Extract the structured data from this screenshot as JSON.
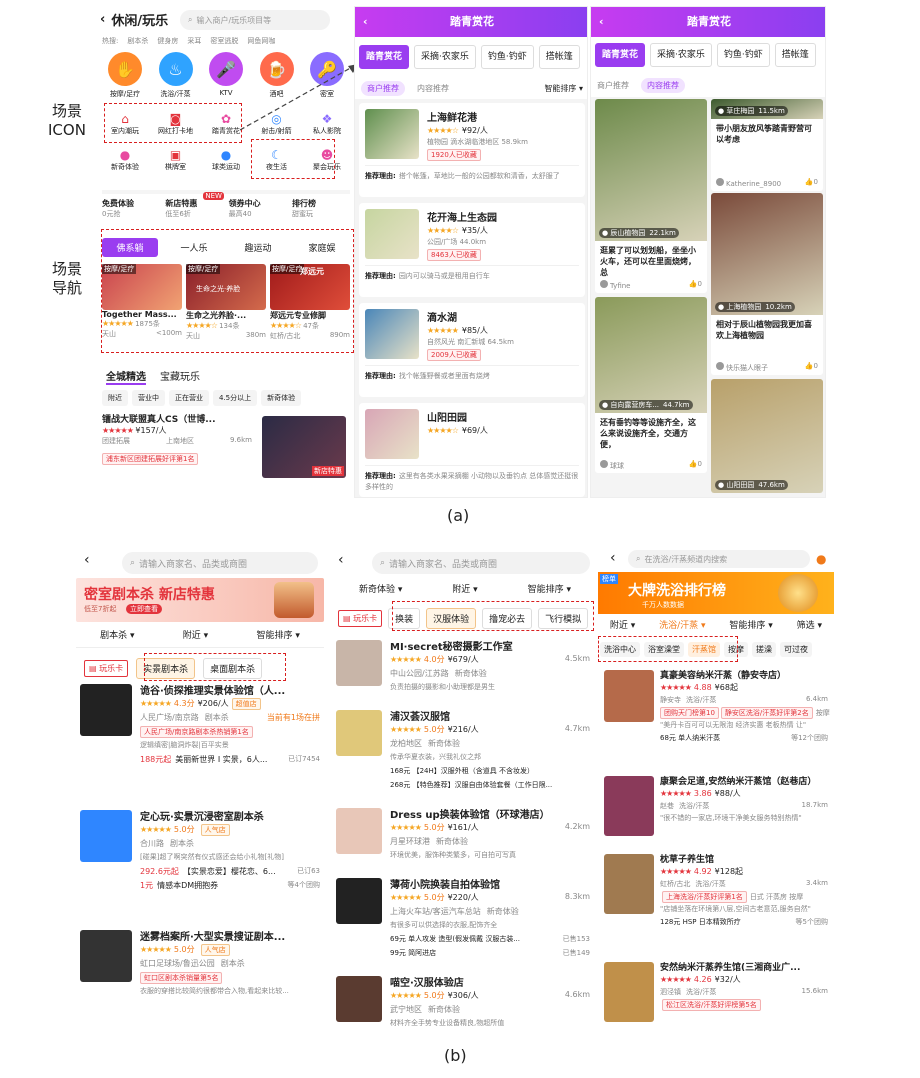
{
  "annot": {
    "scene_icon": "场景\nICON",
    "scene_nav": "场景\n导航",
    "cap_a": "(a)",
    "cap_b": "(b)"
  },
  "a1": {
    "title": "休闲/玩乐",
    "search_ph": "输入商户/玩乐项目等",
    "hot_label": "热搜:",
    "hot": [
      "剧本杀",
      "健身房",
      "采耳",
      "密室逃脱",
      "网鱼网咖"
    ],
    "icons": [
      {
        "label": "按摩/足疗",
        "color": "#ff8a2b",
        "glyph": "✋"
      },
      {
        "label": "洗浴/汗蒸",
        "color": "#2fa3ff",
        "glyph": "♨"
      },
      {
        "label": "KTV",
        "color": "#c04cf0",
        "glyph": "🎤"
      },
      {
        "label": "酒吧",
        "color": "#ff6a4c",
        "glyph": "🍺"
      },
      {
        "label": "密室",
        "color": "#8a6cff",
        "glyph": "🔑"
      }
    ],
    "scene1": [
      "室内潮玩",
      "网红打卡地",
      "踏青赏花"
    ],
    "row2_extra": [
      "射击/射箭",
      "私人影院"
    ],
    "row3": [
      "新奇体验",
      "棋牌室",
      "球类运动"
    ],
    "scene2": [
      "夜生活",
      "聚会玩乐"
    ],
    "promo": [
      {
        "title": "免费体验",
        "sub": "0元抢"
      },
      {
        "title": "新店特惠",
        "sub": "低至6折"
      },
      {
        "title": "领券中心",
        "sub": "最高40"
      },
      {
        "title": "排行榜",
        "sub": "甜蜜玩"
      }
    ],
    "new_badge": "NEW",
    "nav": [
      "佛系躺",
      "一人乐",
      "趣运动",
      "家庭娱"
    ],
    "shops": [
      {
        "tag": "按摩/足疗",
        "name": "Together Mass...",
        "count": "1875条",
        "area": "天山",
        "dist": "<100m"
      },
      {
        "tag": "按摩/足疗",
        "name": "生命之光养脸·...",
        "count": "134条",
        "area": "天山",
        "dist": "380m"
      },
      {
        "tag": "按摩/足疗",
        "name": "郑远元专业修脚",
        "count": "47条",
        "area": "虹桥/古北",
        "dist": "890m"
      }
    ],
    "img_text": [
      "生命之光·养脸",
      "郑远元"
    ],
    "sec_tabs": [
      "全城精选",
      "宝藏玩乐"
    ],
    "filters": [
      "附近",
      "营业中",
      "正在营业",
      "4.5分以上",
      "新奇体验"
    ],
    "deal": {
      "name": "镭战大联盟真人CS（世博...",
      "price": "¥157/人",
      "cat": "团建拓展",
      "area": "上南地区",
      "dist": "9.6km",
      "rank": "浦东新区团建拓展好评第1名",
      "thumb_label": "新店特惠"
    }
  },
  "a2": {
    "title": "踏青赏花",
    "tabs": [
      "踏青赏花",
      "采摘·农家乐",
      "钓鱼·钓虾",
      "搭帐篷"
    ],
    "sub": [
      "商户推荐",
      "内容推荐"
    ],
    "sort": "智能排序",
    "items": [
      {
        "name": "上海鲜花港",
        "price": "¥92/人",
        "loc": "植物园 滴水湖临港地区 58.9km",
        "coll": "1920人已收藏",
        "reason_label": "推荐理由:",
        "reason": "搭个帐篷，草地比一般的公园都软和清香，太舒服了"
      },
      {
        "name": "花开海上生态园",
        "price": "¥35/人",
        "loc": "公园/广场 44.0km",
        "coll": "8463人已收藏",
        "reason_label": "推荐理由:",
        "reason": "园内可以骑马或是租用自行车"
      },
      {
        "name": "滴水湖",
        "price": "¥85/人",
        "loc": "自然风光 南汇新城 64.5km",
        "coll": "2009人已收藏",
        "reason_label": "推荐理由:",
        "reason": "找个帐篷野餐或者里面有烧烤"
      },
      {
        "name": "山阳田园",
        "price": "¥69/人",
        "loc": "",
        "coll": "",
        "reason_label": "推荐理由:",
        "reason": "这里有各类水果采摘棚 小动物以及垂钓点 总体感觉还挺很多样性的"
      }
    ]
  },
  "a3": {
    "title": "踏青赏花",
    "tabs": [
      "踏青赏花",
      "采摘·农家乐",
      "钓鱼·钓虾",
      "搭帐篷"
    ],
    "sub": [
      "商户推荐",
      "内容推荐"
    ],
    "posts": [
      {
        "loc": "辰山植物园",
        "dist": "22.1km",
        "text": "逛累了可以划划船，坐坐小火车，还可以在里面烧烤，总",
        "user": "Tyfine",
        "likes": "0"
      },
      {
        "loc": "草庄梅园",
        "dist": "11.5km",
        "text": "带小朋友放风筝踏青野营可以考虑",
        "user": "Katherine_8900",
        "likes": "0"
      },
      {
        "loc": "上海植物园",
        "dist": "10.2km",
        "text": "相对于辰山植物园我更加喜欢上海植物园",
        "user": "快乐猫人眼子",
        "likes": "0"
      },
      {
        "loc": "自向露营房车...",
        "dist": "44.7km",
        "text": "还有垂钓等等设施齐全，这么来说设施齐全，交通方便，",
        "user": "球球",
        "likes": "0"
      },
      {
        "loc": "山阳田园",
        "dist": "47.6km",
        "text": "",
        "user": "",
        "likes": ""
      }
    ]
  },
  "b1": {
    "search_ph": "请输入商家名、品类或商圈",
    "banner": "密室剧本杀 新店特惠",
    "banner_sub": "低至7折起",
    "banner_btn": "立即查看",
    "filters": [
      "剧本杀",
      "附近",
      "智能排序"
    ],
    "card": "玩乐卡",
    "chips": [
      "实景剧本杀",
      "桌面剧本杀"
    ],
    "items": [
      {
        "name": "诡谷·侦探推理实景体验馆（人...",
        "score": "4.3分",
        "price": "¥206/人",
        "badge": "超值店",
        "area": "人民广场/南京路",
        "cat": "剧本杀",
        "extra": "当前有1场在拼",
        "rank": "人民广场/南京路剧本杀热销第1名",
        "tip": "逻辑缜密|脑洞炸裂|百平实景",
        "deal": "188元起",
        "deal_t": "美丽新世界 I 实景，6人...",
        "sold": "已订7454"
      },
      {
        "name": "定心玩·实景沉浸密室剧本杀",
        "score": "5.0分",
        "price": "",
        "badge": "人气店",
        "area": "合川路",
        "cat": "剧本杀",
        "extra": "",
        "rank": "",
        "tip": "[碰果]超了啊突然有仪式感还会给小礼物[礼物]",
        "deal": "292.6元起",
        "deal_t": "【实景恋爱】樱花恋、6...",
        "sold": "已订63",
        "deal2": "1元",
        "deal2_t": "情感本DM拥抱券",
        "sold2": "等4个团购"
      },
      {
        "name": "迷雾档案所·大型实景搜证剧本...",
        "score": "5.0分",
        "price": "",
        "badge": "人气店",
        "area": "虹口足球场/鲁迅公园",
        "cat": "剧本杀",
        "extra": "",
        "rank": "虹口区剧本杀销量第5名",
        "tip": "衣服的穿搭比较简约很都带合入物,看起来比较...",
        "deal": "",
        "deal_t": "",
        "sold": ""
      }
    ]
  },
  "b2": {
    "search_ph": "请输入商家名、品类或商圈",
    "filters": [
      "新奇体验",
      "附近",
      "智能排序"
    ],
    "card": "玩乐卡",
    "chips": [
      "换装",
      "汉服体验",
      "撸宠必去",
      "飞行模拟"
    ],
    "items": [
      {
        "name": "MI·secret秘密摄影工作室",
        "score": "4.0分",
        "price": "¥679/人",
        "area": "中山公园/江苏路",
        "cat": "新奇体验",
        "dist": "4.5km",
        "tip": "负责拍摄的摄影和小助理都是男生",
        "d1": "",
        "d2": ""
      },
      {
        "name": "浦汉荟汉服馆",
        "score": "5.0分",
        "price": "¥216/人",
        "area": "龙柏地区",
        "cat": "新奇体验",
        "dist": "4.7km",
        "tip": "传承华夏衣装，兴我礼仪之邦",
        "d1": "168元 【24H】汉服外租（含道具 不含妆发）",
        "d2": "268元 【特色推荐】汉服自由体验套餐（工作日限..."
      },
      {
        "name": "Dress up换装体验馆（环球港店）",
        "score": "5.0分",
        "price": "¥161/人",
        "area": "月星环球港",
        "cat": "新奇体验",
        "dist": "4.2km",
        "tip": "环境优美，服饰种类繁多，可自拍可写真",
        "d1": "",
        "d2": ""
      },
      {
        "name": "薄荷小院换装自拍体验馆",
        "score": "5.0分",
        "price": "¥220/人",
        "area": "上海火车站/客运汽车总站",
        "cat": "新奇体验",
        "dist": "8.3km",
        "tip": "有很多可以供选择的衣服,配饰齐全",
        "d1": "69元 单人攻发 造型(假发佩戴 汉服古装...",
        "d2": "99元 简阿进店",
        "s1": "已售153",
        "s2": "已售149"
      },
      {
        "name": "喵空·汉服体验店",
        "score": "5.0分",
        "price": "¥306/人",
        "area": "武宁地区",
        "cat": "新奇体验",
        "dist": "4.6km",
        "tip": "材料齐全手势专业设备精良,物超所值",
        "d1": "",
        "d2": ""
      }
    ]
  },
  "b3": {
    "search_ph": "在洗浴/汗蒸频道内搜索",
    "banner": "大牌洗浴排行榜",
    "banner_tag": "榜单",
    "banner_sub": "千万人数数据",
    "filters": [
      "附近",
      "洗浴/汗蒸",
      "智能排序",
      "筛选"
    ],
    "chips": [
      "洗浴中心",
      "浴室澡堂",
      "汗蒸馆",
      "按摩",
      "搓澡",
      "可过夜"
    ],
    "items": [
      {
        "name": "真豪美容纳米汗蒸（静安寺店）",
        "score": "4.88",
        "price": "¥68起",
        "area": "静安寺",
        "cat": "洗浴/汗蒸",
        "dist": "6.4km",
        "rank": "静安区洗浴/汗蒸好评第2名",
        "rank2": "团购天门榜第10",
        "extra": "按摩",
        "quote": "\"美丹卡百可可以无限泡 经济实惠 老板热情 让\"",
        "deal": "68元 单人纳米汗蒸",
        "deal_n": "等12个团购"
      },
      {
        "name": "康聚会足道,安然纳米汗蒸馆（赵巷店）",
        "score": "3.86",
        "price": "¥88/人",
        "area": "赵巷",
        "cat": "洗浴/汗蒸",
        "dist": "18.7km",
        "rank": "",
        "quote": "\"很不错的一家店,环境干净美女服务特别热情\"",
        "deal": "",
        "deal_n": ""
      },
      {
        "name": "枕草子养生馆",
        "score": "4.92",
        "price": "¥128起",
        "area": "虹桥/古北",
        "cat": "洗浴/汗蒸",
        "dist": "3.4km",
        "rank": "上海洗浴/汗蒸好评第1名",
        "rank2": "",
        "extra": "日式 汗蒸房 按摩",
        "quote": "\"店铺坐落在环境第八层,空间古老意范,服务自然\"",
        "deal": "128元 HSP 日本精致所疗",
        "deal_n": "等5个团购"
      },
      {
        "name": "安然纳米汗蒸养生馆(三湘商业广...",
        "score": "4.26",
        "price": "¥32/人",
        "area": "泗泾镇",
        "cat": "洗浴/汗蒸",
        "dist": "15.6km",
        "rank": "松江区洗浴/汗蒸好评榜第5名",
        "quote": "",
        "deal": "",
        "deal_n": ""
      }
    ]
  }
}
